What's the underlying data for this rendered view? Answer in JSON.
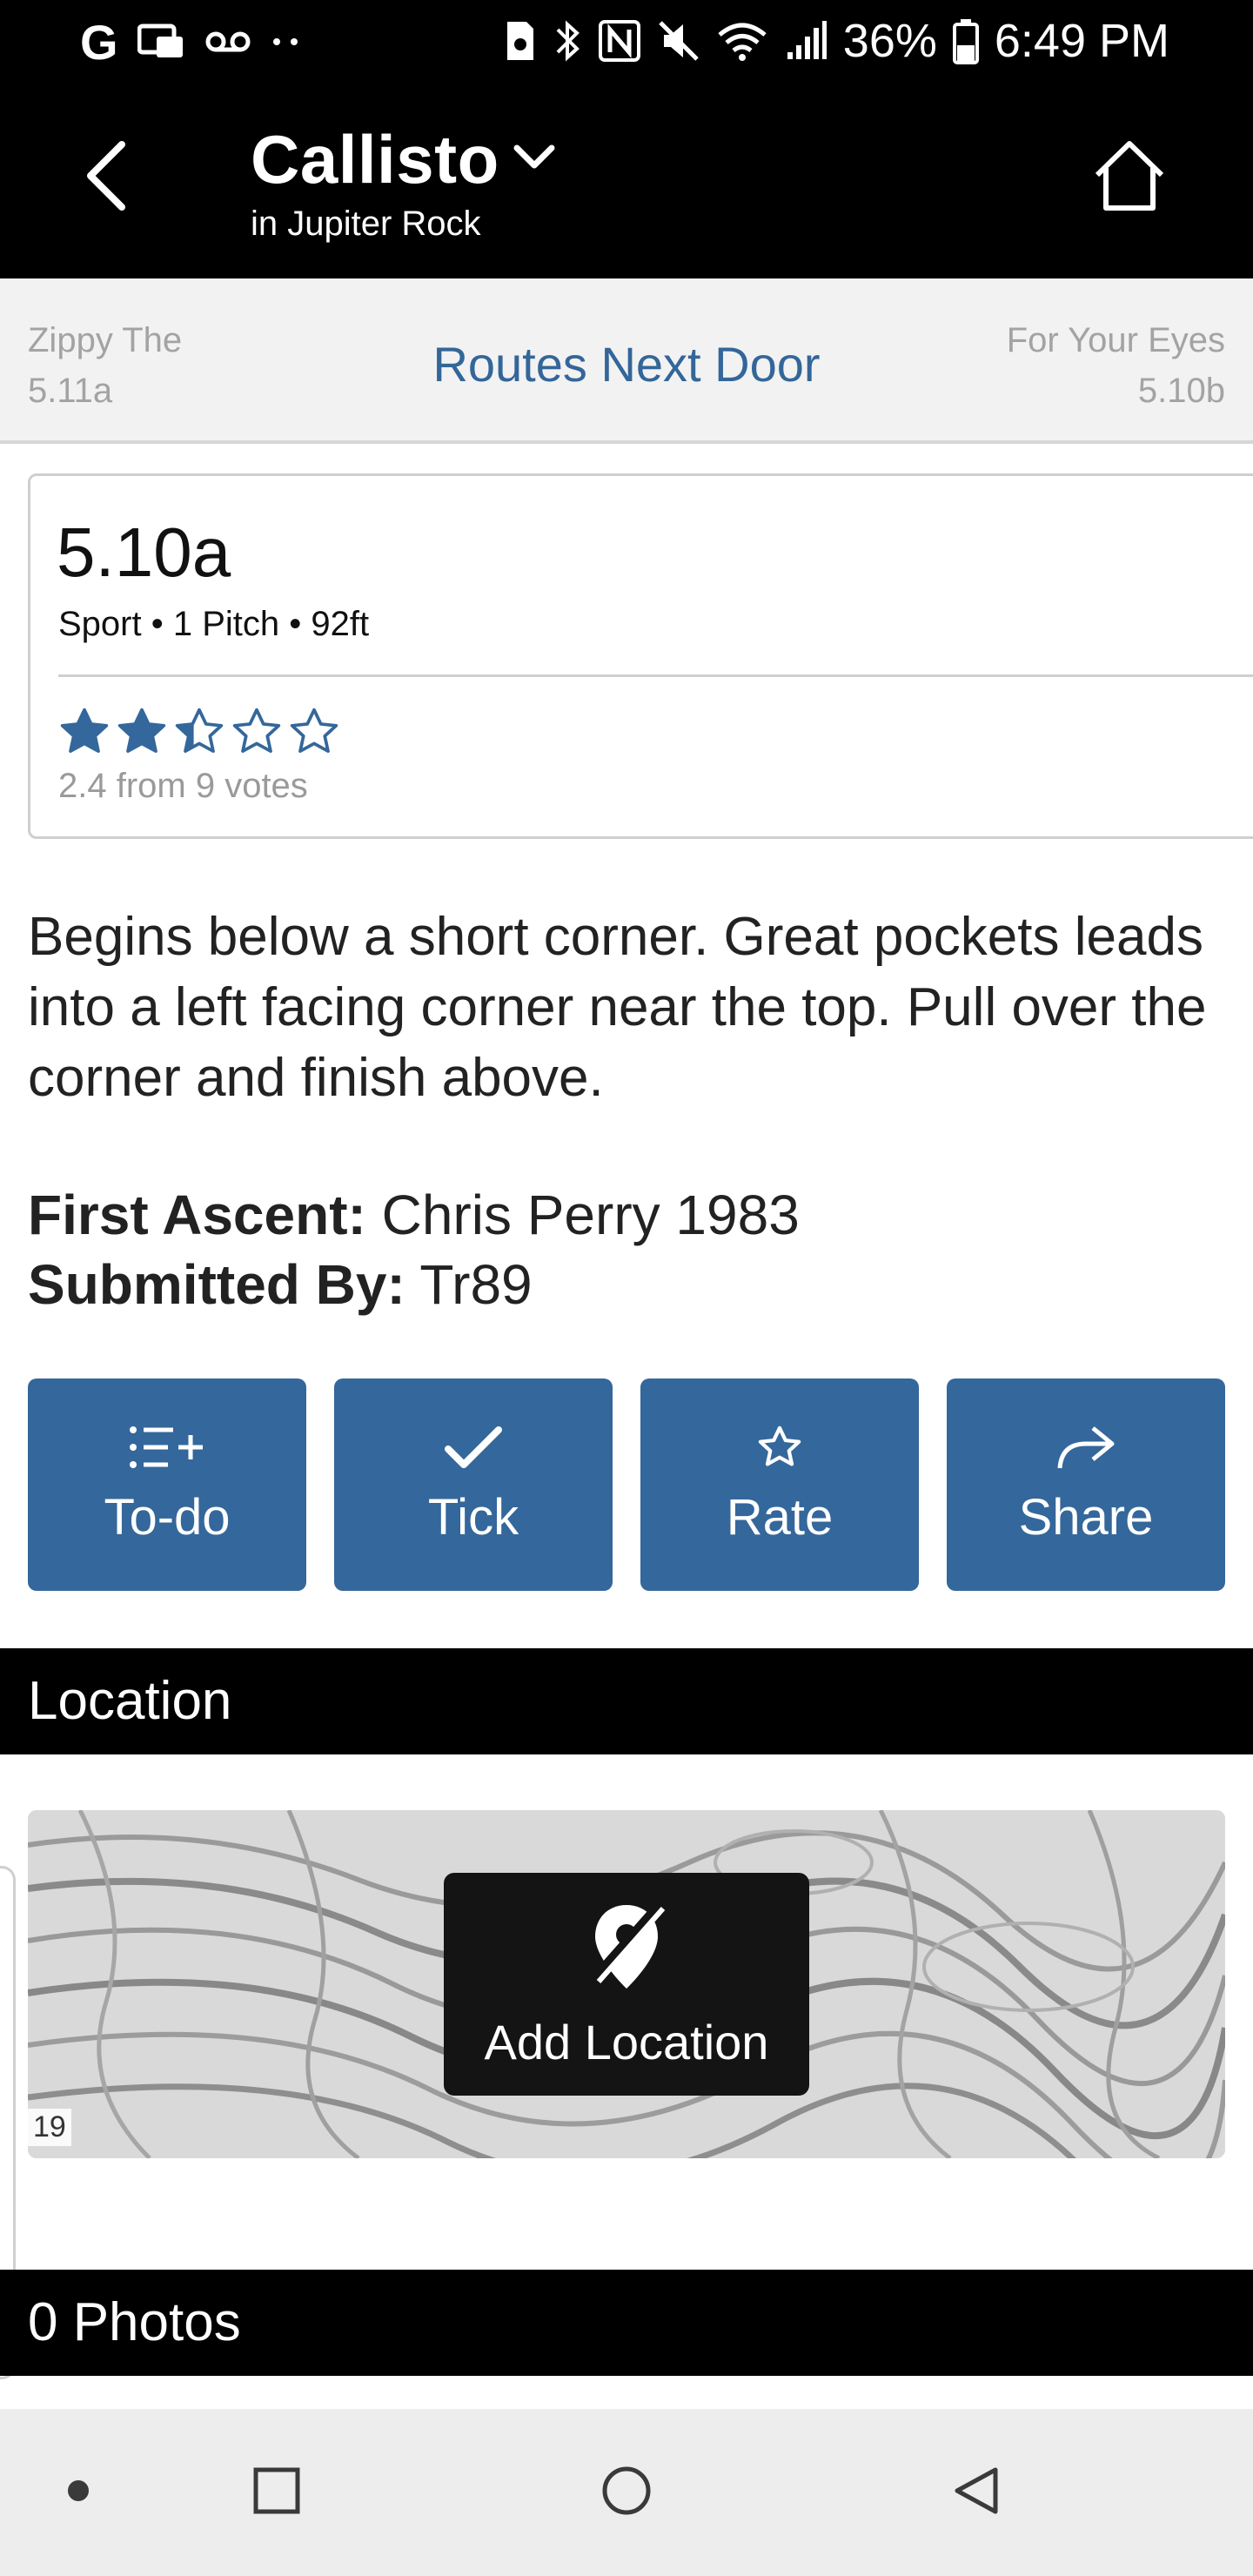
{
  "status_bar": {
    "battery": "36%",
    "time": "6:49 PM"
  },
  "header": {
    "title": "Callisto",
    "subtitle": "in Jupiter Rock"
  },
  "route_nav": {
    "prev_name": "Zippy The",
    "prev_grade": "5.11a",
    "center_label": "Routes Next Door",
    "next_name": "For Your Eyes",
    "next_grade": "5.10b"
  },
  "route": {
    "grade": "5.10a",
    "meta": "Sport • 1 Pitch • 92ft",
    "rating": 2.4,
    "rating_max": 5,
    "votes_text": "2.4 from 9 votes",
    "description": "Begins below a short corner. Great pockets leads into a left facing corner near the top. Pull over the corner and finish above.",
    "first_ascent_label": "First Ascent:",
    "first_ascent_value": "Chris Perry 1983",
    "submitted_label": "Submitted By:",
    "submitted_value": "Tr89"
  },
  "actions": {
    "todo": "To-do",
    "tick": "Tick",
    "rate": "Rate",
    "share": "Share"
  },
  "location": {
    "header": "Location",
    "add_label": "Add Location",
    "map_scale": "19"
  },
  "photos": {
    "header": "0 Photos"
  },
  "colors": {
    "accent": "#34679b",
    "link": "#336699",
    "muted": "#a3a3a3"
  },
  "icons": [
    "back-arrow-icon",
    "chevron-down-icon",
    "home-icon",
    "star-icon",
    "list-add-icon",
    "check-icon",
    "share-arrow-icon",
    "location-off-icon"
  ]
}
